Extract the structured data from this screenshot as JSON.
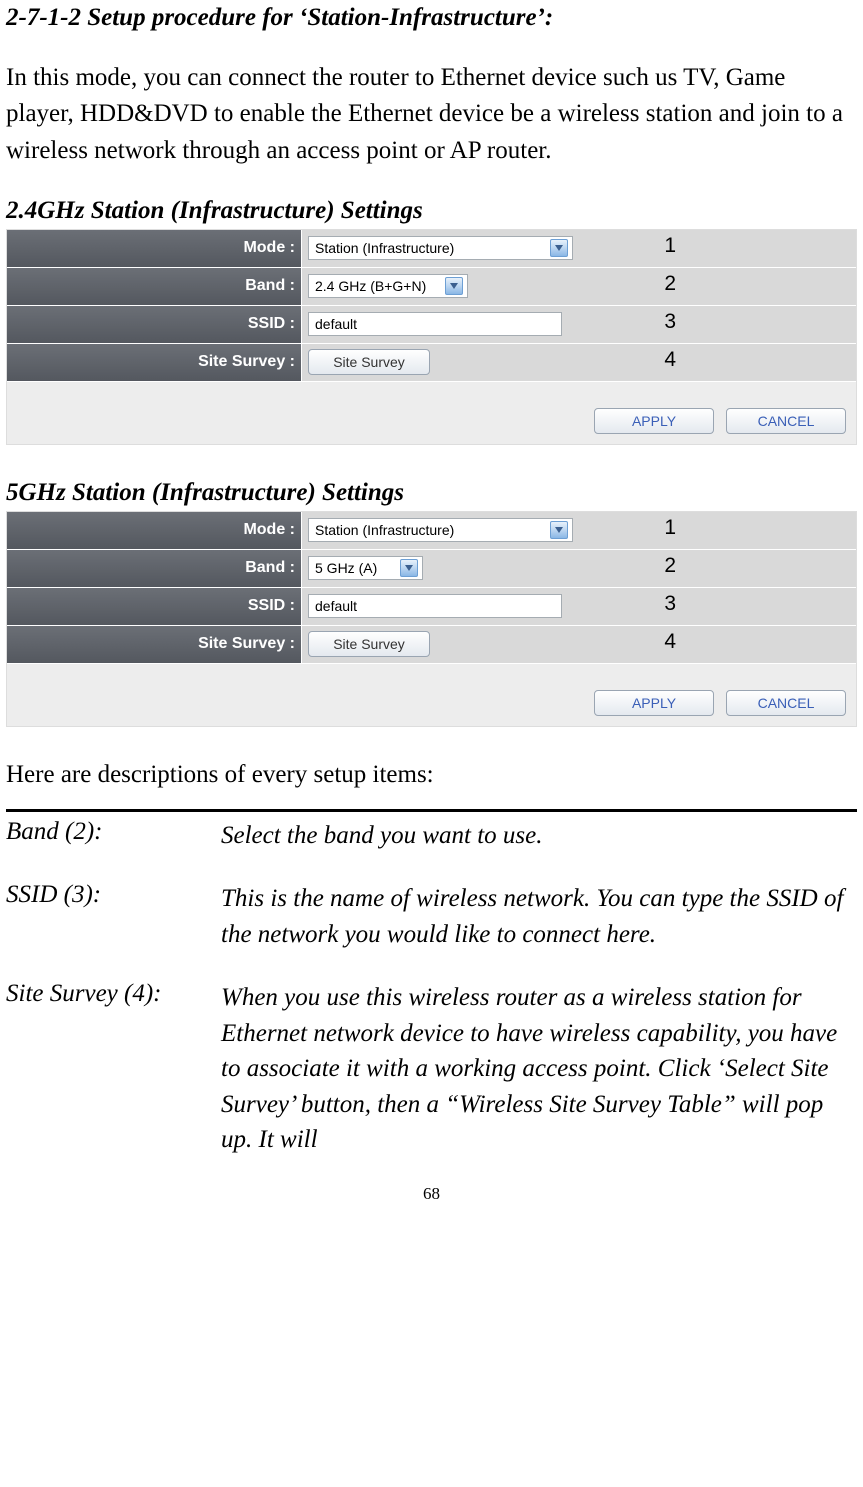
{
  "heading": "2-7-1-2 Setup procedure for ‘Station-Infrastructure’:",
  "intro": "In this mode, you can connect the router to Ethernet device such us TV, Game player, HDD&DVD to enable the Ethernet device be a wireless station and join to a wireless network through an access point or AP router.",
  "panel24": {
    "title": "2.4GHz Station (Infrastructure) Settings",
    "rows": {
      "mode_label": "Mode :",
      "mode_value": "Station (Infrastructure)",
      "band_label": "Band :",
      "band_value": "2.4 GHz (B+G+N)",
      "ssid_label": "SSID :",
      "ssid_value": "default",
      "survey_label": "Site Survey :",
      "survey_btn": "Site Survey"
    },
    "callouts": {
      "c1": "1",
      "c2": "2",
      "c3": "3",
      "c4": "4"
    },
    "apply": "APPLY",
    "cancel": "CANCEL"
  },
  "panel5": {
    "title": "5GHz Station (Infrastructure) Settings",
    "rows": {
      "mode_label": "Mode :",
      "mode_value": "Station (Infrastructure)",
      "band_label": "Band :",
      "band_value": "5 GHz (A)",
      "ssid_label": "SSID :",
      "ssid_value": "default",
      "survey_label": "Site Survey :",
      "survey_btn": "Site Survey"
    },
    "callouts": {
      "c1": "1",
      "c2": "2",
      "c3": "3",
      "c4": "4"
    },
    "apply": "APPLY",
    "cancel": "CANCEL"
  },
  "desc_intro": "Here are descriptions of every setup items:",
  "defs": {
    "band_term": "Band (2):",
    "band_desc": "Select the band you want to use.",
    "ssid_term": "SSID (3):",
    "ssid_desc": "This is the name of wireless network. You can type the SSID of the network you would like to connect here.",
    "survey_term": "Site Survey (4):",
    "survey_desc": "When you use this wireless router as a wireless station for Ethernet network device to have wireless capability, you have to associate it with a working access point. Click ‘Select Site Survey’ button, then a “Wireless Site Survey Table” will pop up. It will"
  },
  "page_number": "68"
}
